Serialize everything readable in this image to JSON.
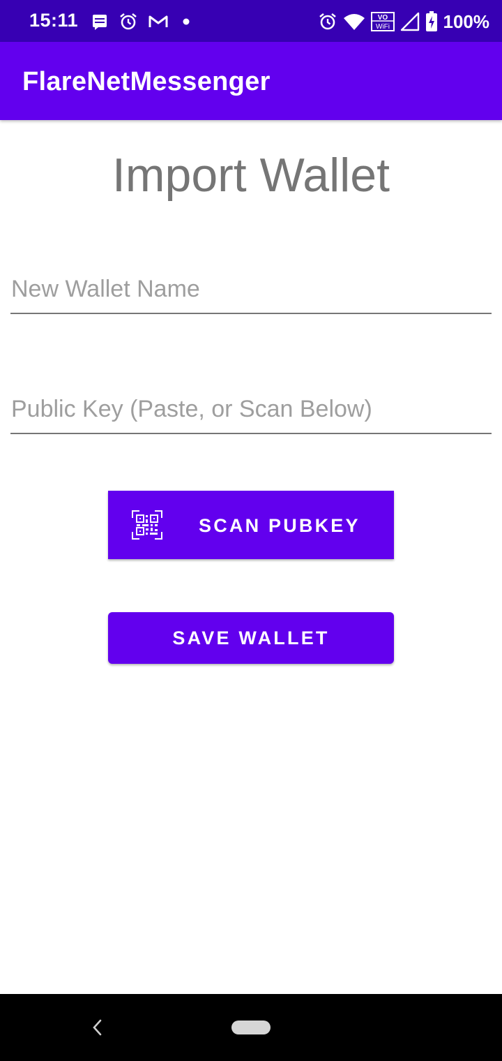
{
  "status_bar": {
    "time": "15:11",
    "battery": "100%",
    "left_icons": [
      "message-icon",
      "alarm-icon",
      "gmail-icon",
      "dot-icon"
    ],
    "right_icons": [
      "alarm-icon",
      "wifi-icon",
      "vowifi-icon",
      "signal-icon",
      "battery-icon"
    ],
    "vowifi_top": "VO",
    "vowifi_bottom": "WiFi"
  },
  "app_bar": {
    "title": "FlareNetMessenger"
  },
  "page": {
    "title": "Import Wallet",
    "wallet_name_placeholder": "New Wallet Name",
    "wallet_name_value": "",
    "pubkey_placeholder": "Public Key (Paste, or Scan Below)",
    "pubkey_value": "",
    "scan_button_label": "SCAN PUBKEY",
    "scan_button_icon": "qr-code-scan-icon",
    "save_button_label": "SAVE WALLET"
  },
  "colors": {
    "status_bar": "#3700b3",
    "primary": "#6200ee",
    "title_text": "#757575",
    "hint_text": "#9e9e9e"
  },
  "nav_bar": {
    "icons": [
      "back-icon",
      "home-pill-icon"
    ]
  }
}
